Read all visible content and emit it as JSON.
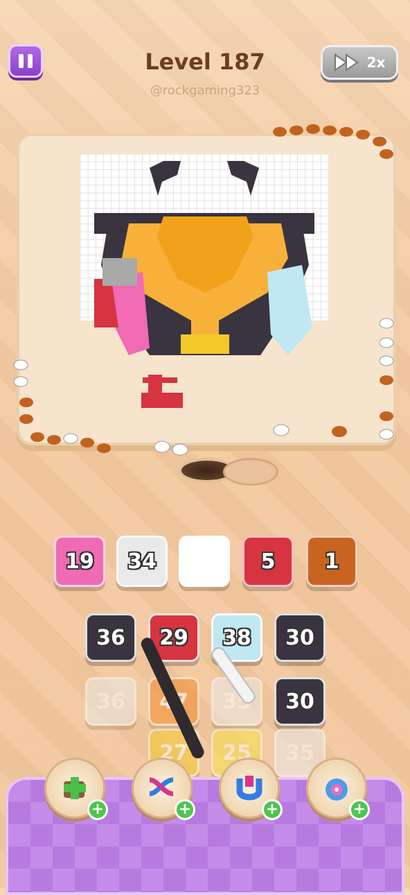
{
  "header": {
    "title": "Level 187",
    "handle": "@rockgaming323",
    "speed_label": "2x"
  },
  "bank_slots": [
    {
      "value": "19",
      "color": "#f06ab4"
    },
    {
      "value": "34",
      "color": "#e9e9e9"
    },
    {
      "value": "",
      "color": "#ffffff"
    },
    {
      "value": "5",
      "color": "#d63440"
    },
    {
      "value": "1",
      "color": "#c8641f"
    }
  ],
  "grid_tiles": [
    {
      "value": "36",
      "color": "#3a3440"
    },
    {
      "value": "29",
      "color": "#d63440"
    },
    {
      "value": "38",
      "color": "#bfe8f3"
    },
    {
      "value": "30",
      "color": "#3a3440"
    },
    {
      "value": "36",
      "color": "#e9e9e9"
    },
    {
      "value": "47",
      "color": "#f28a2c"
    },
    {
      "value": "35",
      "color": "#e9e9e9"
    },
    {
      "value": "30",
      "color": "#3a3440"
    },
    {
      "value": "27",
      "color": "#f5c82a"
    },
    {
      "value": "25",
      "color": "#f5e24a"
    },
    {
      "value": "35",
      "color": "#e9e9e9"
    }
  ],
  "powerups": [
    {
      "icon": "add-box-icon"
    },
    {
      "icon": "shuffle-icon"
    },
    {
      "icon": "magnet-icon"
    },
    {
      "icon": "flower-icon"
    }
  ],
  "colors": {
    "accent": "#8c3fc9",
    "brown_text": "#6b3f1e"
  }
}
